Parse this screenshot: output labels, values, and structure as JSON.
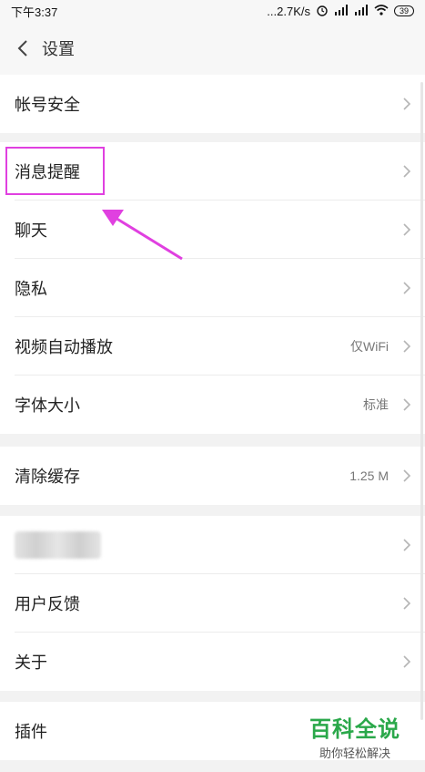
{
  "status_bar": {
    "time": "下午3:37",
    "network_speed": "...2.7K/s",
    "battery": "39"
  },
  "header": {
    "title": "设置",
    "back_icon": "chevron-left-icon"
  },
  "sections": [
    {
      "items": [
        {
          "label": "帐号安全",
          "value": ""
        }
      ]
    },
    {
      "items": [
        {
          "label": "消息提醒",
          "value": ""
        },
        {
          "label": "聊天",
          "value": ""
        },
        {
          "label": "隐私",
          "value": ""
        },
        {
          "label": "视频自动播放",
          "value": "仅WiFi"
        },
        {
          "label": "字体大小",
          "value": "标准"
        }
      ]
    },
    {
      "items": [
        {
          "label": "清除缓存",
          "value": "1.25 M"
        }
      ]
    },
    {
      "items": [
        {
          "label": "",
          "value": ""
        },
        {
          "label": "用户反馈",
          "value": ""
        },
        {
          "label": "关于",
          "value": ""
        }
      ]
    },
    {
      "items": [
        {
          "label": "插件",
          "value": ""
        }
      ]
    }
  ],
  "annotation": {
    "highlight_color": "#e040e0"
  },
  "watermark": {
    "main": "百科全说",
    "sub": "助你轻松解决"
  }
}
